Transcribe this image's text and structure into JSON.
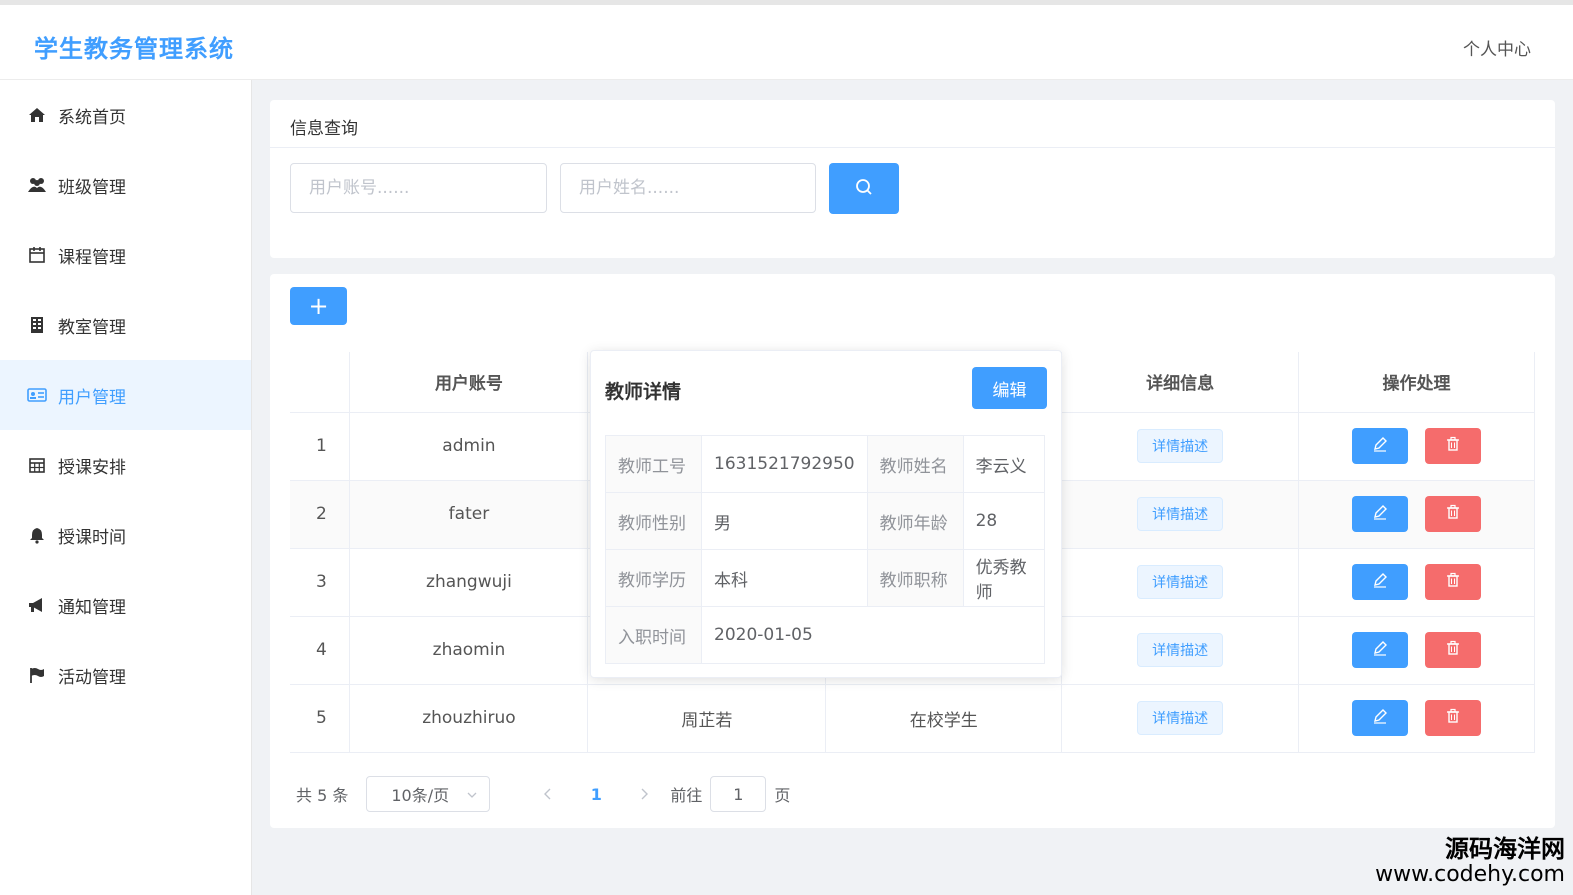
{
  "app": {
    "title": "学生教务管理系统",
    "user_center": "个人中心"
  },
  "sidebar": {
    "items": [
      {
        "label": "系统首页",
        "icon": "home-icon"
      },
      {
        "label": "班级管理",
        "icon": "users-icon"
      },
      {
        "label": "课程管理",
        "icon": "calendar-icon"
      },
      {
        "label": "教室管理",
        "icon": "building-icon"
      },
      {
        "label": "用户管理",
        "icon": "id-card-icon",
        "active": true
      },
      {
        "label": "授课安排",
        "icon": "calendar-grid-icon"
      },
      {
        "label": "授课时间",
        "icon": "bell-icon"
      },
      {
        "label": "通知管理",
        "icon": "bullhorn-icon"
      },
      {
        "label": "活动管理",
        "icon": "flag-icon"
      }
    ]
  },
  "search": {
    "header": "信息查询",
    "account_placeholder": "用户账号......",
    "name_placeholder": "用户姓名......"
  },
  "table": {
    "add_label": "+",
    "headers": {
      "index": "",
      "account": "用户账号",
      "name": "",
      "role": "",
      "details": "详细信息",
      "actions": "操作处理"
    },
    "detail_tag": "详情描述",
    "rows": [
      {
        "index": "1",
        "account": "admin",
        "name": "",
        "role": ""
      },
      {
        "index": "2",
        "account": "fater",
        "name": "",
        "role": ""
      },
      {
        "index": "3",
        "account": "zhangwuji",
        "name": "",
        "role": ""
      },
      {
        "index": "4",
        "account": "zhaomin",
        "name": "",
        "role": ""
      },
      {
        "index": "5",
        "account": "zhouzhiruo",
        "name": "周芷若",
        "role": "在校学生"
      }
    ]
  },
  "pagination": {
    "total": "共 5 条",
    "page_size": "10条/页",
    "current": "1",
    "goto_label": "前往",
    "goto_value": "1",
    "page_suffix": "页"
  },
  "popover": {
    "title": "教师详情",
    "edit_label": "编辑",
    "fields": {
      "id_label": "教师工号",
      "id_value": "1631521792950",
      "name_label": "教师姓名",
      "name_value": "李云义",
      "gender_label": "教师性别",
      "gender_value": "男",
      "age_label": "教师年龄",
      "age_value": "28",
      "edu_label": "教师学历",
      "edu_value": "本科",
      "title_label": "教师职称",
      "title_value": "优秀教师",
      "join_label": "入职时间",
      "join_value": "2020-01-05"
    }
  },
  "watermark": {
    "line1": "源码海洋网",
    "line2": "www.codehy.com"
  },
  "colors": {
    "primary": "#409eff",
    "danger": "#f56c6c",
    "active_bg": "#ecf5ff"
  }
}
